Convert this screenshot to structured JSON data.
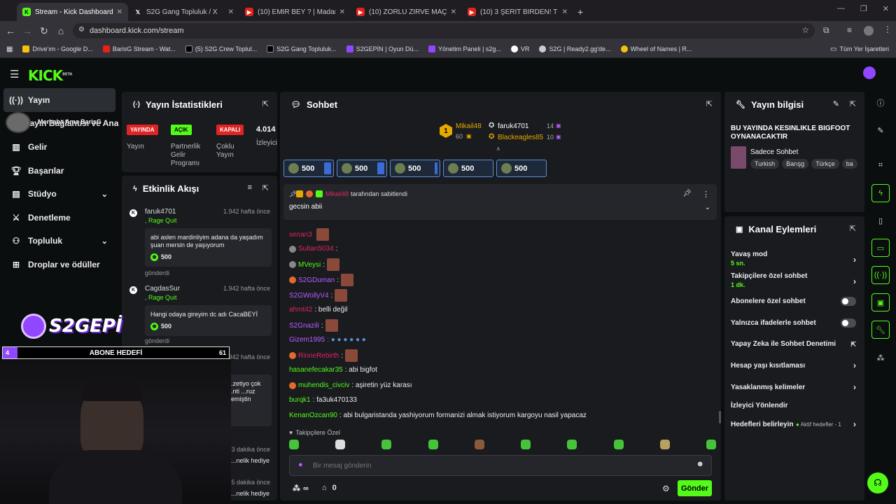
{
  "browser": {
    "tabs": [
      {
        "title": "Stream - Kick Dashboard",
        "favicon": "kick-icon",
        "active": true
      },
      {
        "title": "S2G Gang Topluluk / X",
        "favicon": "x-icon",
        "active": false
      },
      {
        "title": "(10) EMİR BEY ? | Madara Oldu",
        "favicon": "youtube-icon",
        "active": false
      },
      {
        "title": "(10) ZORLU ZİRVE MAÇLARI! H",
        "favicon": "youtube-icon",
        "active": false
      },
      {
        "title": "(10) 3 ŞERİT BİRDEN! Türkiye'd",
        "favicon": "youtube-icon",
        "active": false
      }
    ],
    "new_tab": "+",
    "url": "dashboard.kick.com/stream",
    "bookmarks": [
      {
        "label": "Drive'ım - Google D...",
        "color": "#f4c20d"
      },
      {
        "label": "BarisG Stream - Wat...",
        "color": "#e62117"
      },
      {
        "label": "(5) S2G Crew Toplul...",
        "color": "#000000"
      },
      {
        "label": "S2G Gang Topluluk...",
        "color": "#000000"
      },
      {
        "label": "S2GEPİN | Oyun Dü...",
        "color": "#9146ff"
      },
      {
        "label": "Yönetim Paneli | s2g...",
        "color": "#9146ff"
      },
      {
        "label": "VR",
        "color": "#ffffff"
      },
      {
        "label": "S2G | Ready2.gg'de...",
        "color": "#ffffff"
      },
      {
        "label": "Wheel of Names | R...",
        "color": "#f4c20d"
      }
    ],
    "bookmarks_folder": "Tüm Yer İşaretleri"
  },
  "kick": {
    "logo": "KICK",
    "logo_sup": "BETA",
    "accent": "#53fc18"
  },
  "leftnav": {
    "items": [
      {
        "label": "Yayın",
        "icon": "broadcast-icon",
        "active": true
      },
      {
        "label": "Yayın Bağlantısı ve Anahtarı",
        "icon": "key-icon",
        "active": false
      },
      {
        "label": "Gelir",
        "icon": "chart-icon",
        "active": false
      },
      {
        "label": "Başarılar",
        "icon": "trophy-icon",
        "active": false
      },
      {
        "label": "Stüdyo",
        "icon": "film-icon",
        "active": false,
        "chevron": true
      },
      {
        "label": "Denetleme",
        "icon": "sword-icon",
        "active": false
      },
      {
        "label": "Topluluk",
        "icon": "people-icon",
        "active": false,
        "chevron": true
      },
      {
        "label": "Droplar ve ödüller",
        "icon": "gift-icon",
        "active": false
      }
    ],
    "overlay_name": "Merhaba Ama BarisG"
  },
  "stats": {
    "title": "Yayın İstatistikleri",
    "items": [
      {
        "badge": "YAYINDA",
        "label": "Yayın",
        "badge_color": "#e02424"
      },
      {
        "badge": "AÇIK",
        "label": "Partnerlik Gelir Programı",
        "badge_color": "#53fc18"
      },
      {
        "badge": "KAPALI",
        "label": "Çoklu Yayın",
        "badge_color": "#e02424"
      },
      {
        "badge": "4.014",
        "label": "İzleyici",
        "badge_color": ""
      }
    ]
  },
  "events": {
    "title": "Etkinlik Akışı",
    "items": [
      {
        "user": "faruk4701",
        "time": "1.942 hafta önce",
        "tag": ", Rage Quit",
        "text": "abi aslen mardinliyim adana da yaşadım şuan mersin de yaşıyorum",
        "points": "500",
        "footer": "gönderdi"
      },
      {
        "user": "CagdasSur",
        "time": "1.942 hafta önce",
        "tag": ", Rage Quit",
        "text": "Hangi odaya gireyim dc adı CacaBEYİ",
        "points": "500",
        "footer": "gönderdi"
      },
      {
        "user": "aras5261738166",
        "time": "1.942 hafta önce",
        "tag": "",
        "text": "...zetiyo çok ...nti ...ruz demiştin",
        "points": "",
        "footer": ""
      },
      {
        "user": "",
        "time": "3 dakika önce",
        "tag": "",
        "text": "...nelik hediye",
        "points": "",
        "footer": ""
      },
      {
        "user": "",
        "time": "5 dakika önce",
        "tag": "",
        "text": "...nelik hediye",
        "points": "",
        "footer": ""
      }
    ]
  },
  "overlay": {
    "brand": "S2GEPİ",
    "goal_label": "ABONE HEDEFİ",
    "goal_current": "4",
    "goal_target": "61",
    "goal_progress": 0.0656
  },
  "chat": {
    "title": "Sohbet",
    "leaderboard": [
      {
        "rank": "1",
        "name": "Mikail48",
        "value": "60",
        "color": "#e5a800"
      },
      {
        "rank": "",
        "name": "faruk4701",
        "value": "14",
        "color": "#ffffff"
      },
      {
        "rank": "",
        "name": "Blackeagles85",
        "value": "10",
        "color": "#e5a800"
      }
    ],
    "gifts": [
      "500",
      "500",
      "500",
      "500",
      "500"
    ],
    "pinned": {
      "by": "Mikail48",
      "suffix": "tarafından sabitlendi",
      "text": "gecsin abii"
    },
    "messages": [
      {
        "user": "senan3",
        "color": "#e0245e",
        "text": "",
        "emote": true,
        "badge": false
      },
      {
        "user": "Sultan5034",
        "color": "#e0245e",
        "text": ":",
        "emote": false,
        "badge": true
      },
      {
        "user": "MVeysi",
        "color": "#53fc18",
        "text": ":",
        "emote": true,
        "badge": true
      },
      {
        "user": "S2GDuman",
        "color": "#b85cff",
        "text": ":",
        "emote": true,
        "badge": true
      },
      {
        "user": "S2GWollyV4",
        "color": "#b85cff",
        "text": ":",
        "emote": true,
        "badge": false
      },
      {
        "user": "ahmt42",
        "color": "#e0245e",
        "text": ": belli değil",
        "emote": false,
        "badge": false
      },
      {
        "user": "S2Gnazili",
        "color": "#b85cff",
        "text": ":",
        "emote": true,
        "badge": false
      },
      {
        "user": "Gizem1995",
        "color": "#b85cff",
        "text": ": ● ● ● ● ● ●",
        "emote": false,
        "badge": false
      },
      {
        "user": "RinneRebirth",
        "color": "#e0245e",
        "text": ":",
        "emote": true,
        "badge": true
      },
      {
        "user": "hasanefecakar35",
        "color": "#53fc18",
        "text": ": abi bigfot",
        "emote": false,
        "badge": false
      },
      {
        "user": "muhendis_civciv",
        "color": "#53fc18",
        "text": ": aşiretin yüz karası",
        "emote": false,
        "badge": true
      },
      {
        "user": "burqk1",
        "color": "#53fc18",
        "text": ": fa3uk470133",
        "emote": false,
        "badge": false
      },
      {
        "user": "KenanOzcan90",
        "color": "#53fc18",
        "text": ": abi bulgaristanda yashiyorum formanizi almak istiyorum kargoyu nasil yapacaz",
        "emote": false,
        "badge": false
      }
    ],
    "followers_only": "Takipçilere Özel",
    "input_placeholder": "Bir mesaj gönderin",
    "send": "Gönder",
    "points_label": "∞",
    "store_count": "0"
  },
  "info": {
    "title": "Yayın bilgisi",
    "stream_title": "BU YAYINDA KESINLIKLE BIGFOOT OYNANACAKTIR",
    "category": "Sadece Sohbet",
    "tags": [
      "Turkish",
      "Barışg",
      "Türkçe",
      "ba"
    ]
  },
  "actions": {
    "title": "Kanal Eylemleri",
    "items": [
      {
        "label": "Yavaş mod",
        "sub": "5 sn.",
        "control": "chevron"
      },
      {
        "label": "Takipçilere özel sohbet",
        "sub": "1 dk.",
        "control": "chevron"
      },
      {
        "label": "Abonelere özel sohbet",
        "sub": "",
        "control": "toggle"
      },
      {
        "label": "Yalnızca ifadelerle sohbet",
        "sub": "",
        "control": "toggle"
      },
      {
        "label": "Yapay Zeka ile Sohbet Denetimi",
        "sub": "",
        "control": "external"
      },
      {
        "label": "Hesap yaşı kısıtlaması",
        "sub": "",
        "control": "chevron"
      },
      {
        "label": "Yasaklanmış kelimeler",
        "sub": "",
        "control": "chevron"
      },
      {
        "label": "İzleyici Yönlendir",
        "sub": "",
        "control": "none"
      },
      {
        "label": "Hedefleri belirleyin",
        "sub": "",
        "control": "chevron",
        "extra": "Aktif hedefler - 1"
      }
    ]
  }
}
